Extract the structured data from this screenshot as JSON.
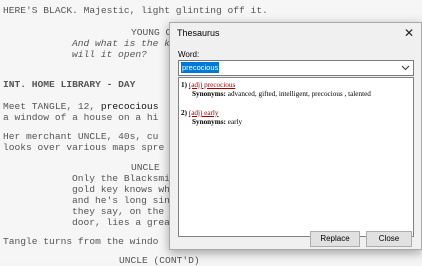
{
  "script": {
    "line1": "HERE'S BLACK. Majestic, light glinting off it.",
    "line2": "YOUNG C",
    "line3": "And what is the k",
    "line4": "will it open?",
    "line5": "INT. HOME LIBRARY - DAY",
    "line6a": "Meet TANGLE, 12, ",
    "line6b": "precocious",
    "line7": "a window of a house on a hi",
    "line8": "Her merchant UNCLE, 40s, cu",
    "line9": "looks over various maps spre",
    "line10": "UNCLE",
    "line11": "Only the Blacksmi",
    "line12": "gold key knows wh",
    "line13": "and he's long sin",
    "line14": "they say, on the",
    "line15": "door, lies a grea",
    "line16": "Tangle turns from the windo",
    "line17": "UNCLE (CONT'D)"
  },
  "dialog": {
    "title": "Thesaurus",
    "close_glyph": "✕",
    "word_label": "Word:",
    "word_value": "precocious",
    "entries": [
      {
        "num": "1)",
        "pos": "(adj) precocious",
        "syn_label": "Synonyms:",
        "synonyms": "advanced, gifted, intelligent, precocious , talented"
      },
      {
        "num": "2)",
        "pos": "(adj) early",
        "syn_label": "Synonyms:",
        "synonyms": "early"
      }
    ],
    "replace_label": "Replace",
    "close_label": "Close"
  },
  "icons": {
    "combo": "chevron-down-icon",
    "close": "close-icon"
  }
}
